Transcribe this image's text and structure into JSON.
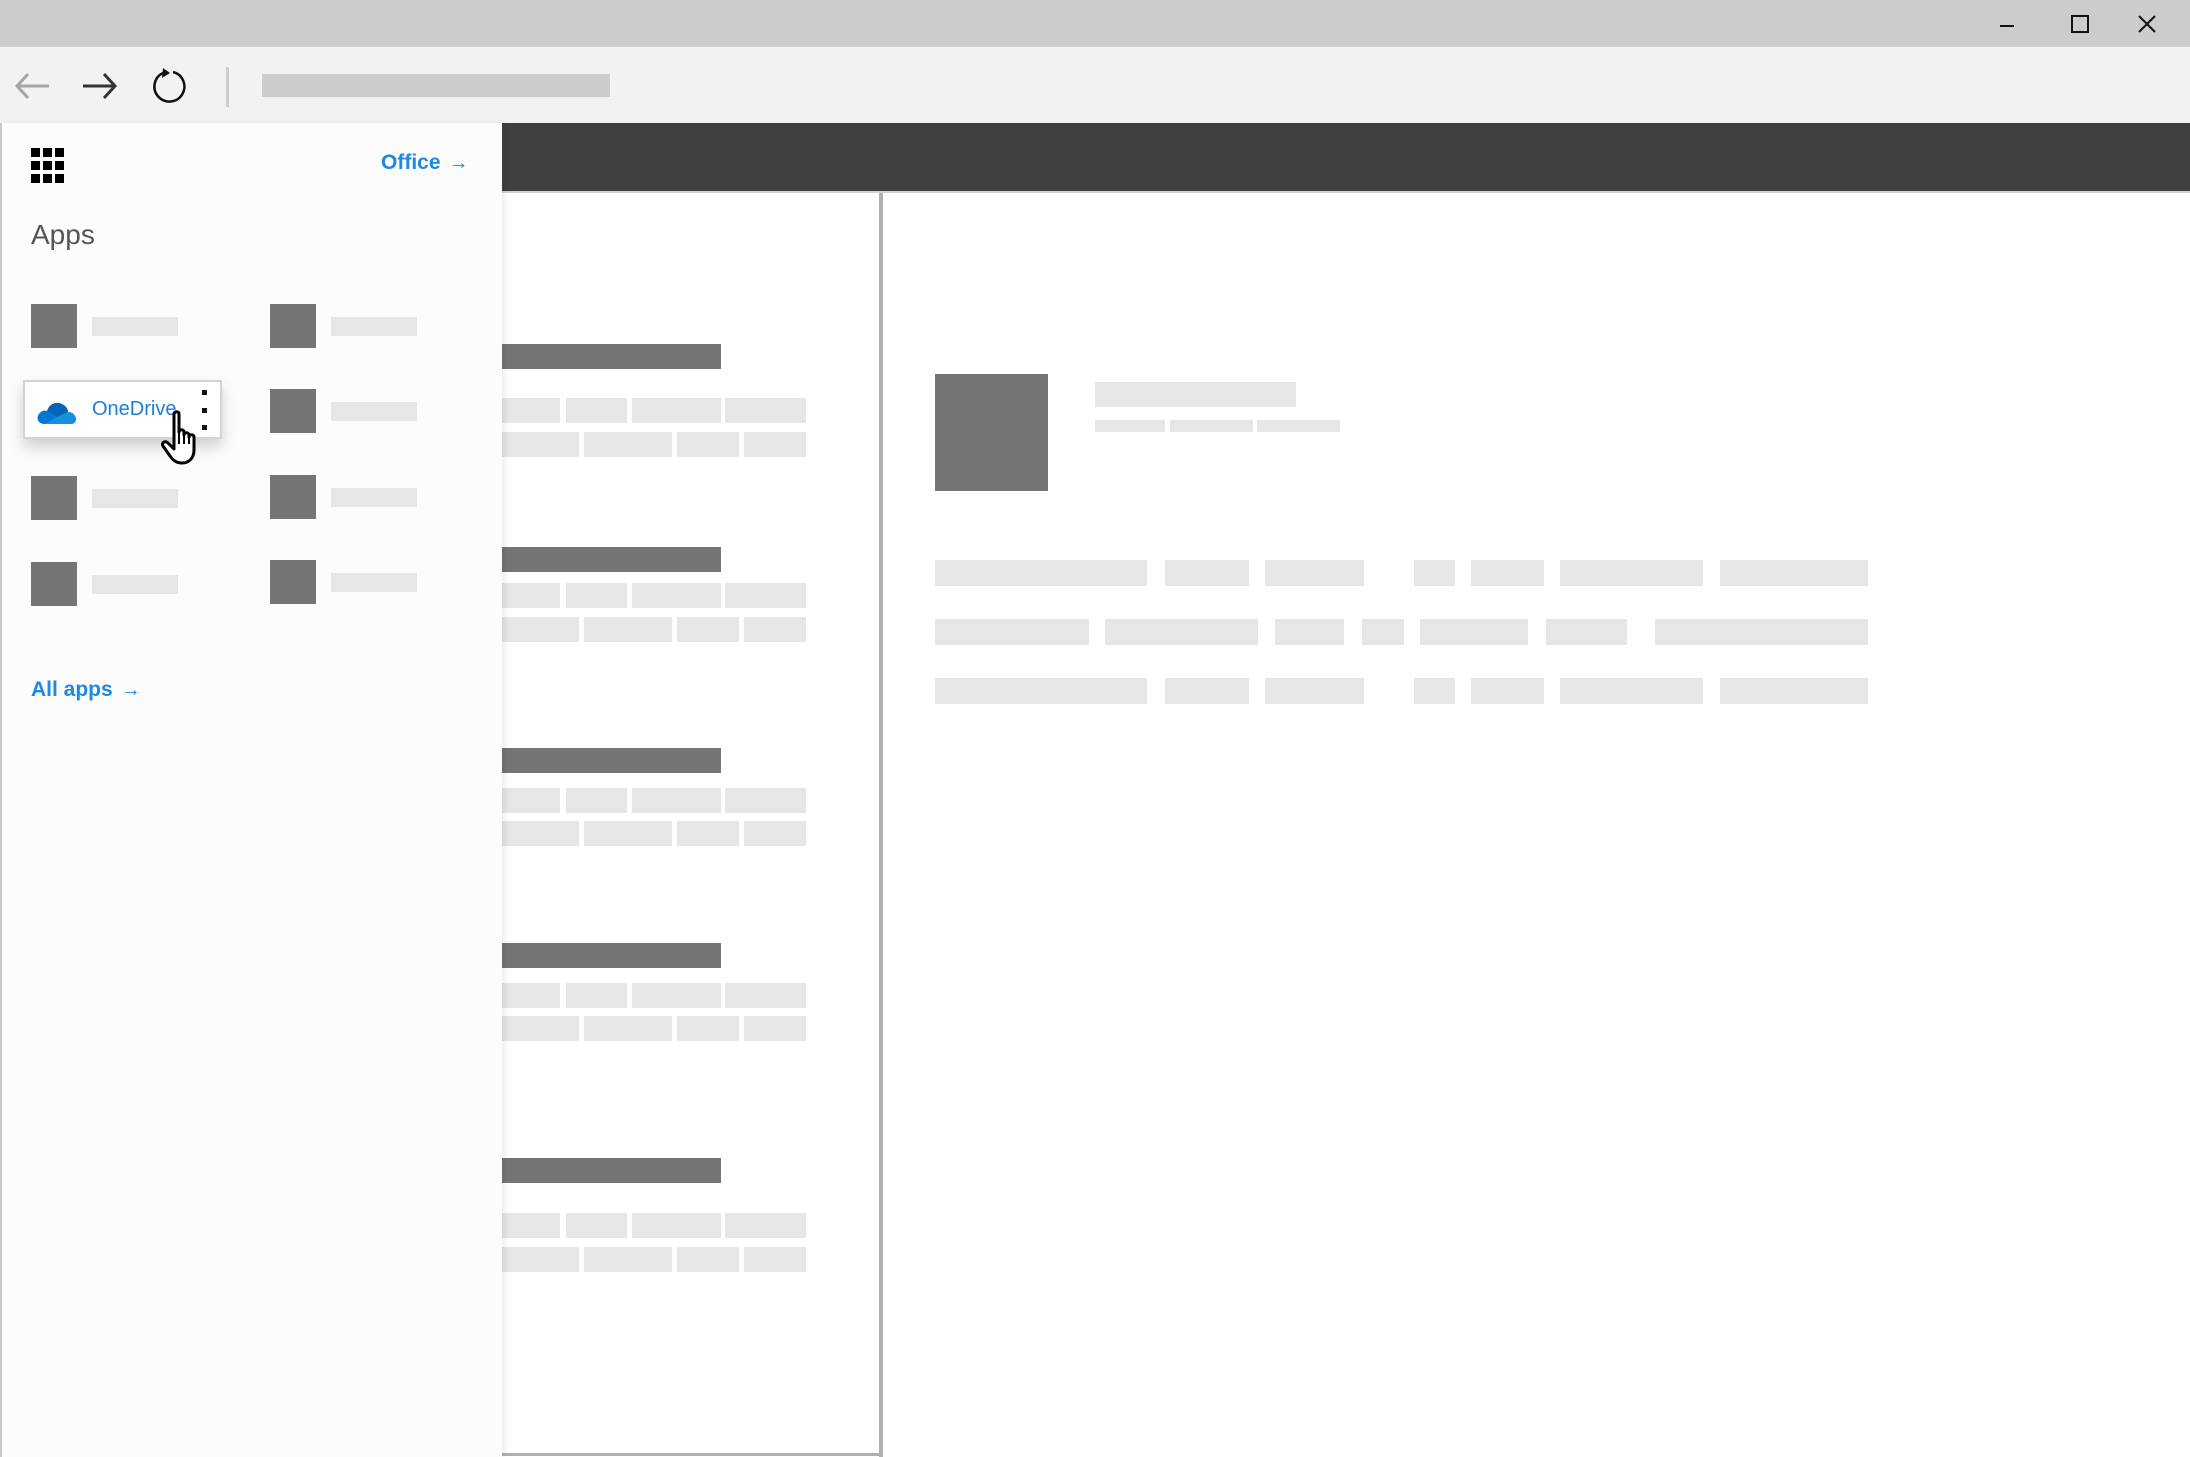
{
  "window": {
    "controls": [
      {
        "name": "minimize",
        "icon": "minimize-icon"
      },
      {
        "name": "maximize",
        "icon": "maximize-icon"
      },
      {
        "name": "close",
        "icon": "close-icon"
      }
    ]
  },
  "browser": {
    "back_icon": "arrow-left-icon",
    "forward_icon": "arrow-right-icon",
    "refresh_icon": "refresh-icon",
    "address_value": ""
  },
  "launcher": {
    "waffle_icon": "app-launcher-icon",
    "office_link": {
      "label": "Office",
      "arrow": "→"
    },
    "section_title": "Apps",
    "apps": [
      {
        "label": "",
        "placeholder": true
      },
      {
        "label": "",
        "placeholder": true
      },
      {
        "label": "OneDrive",
        "placeholder": false,
        "highlighted": true,
        "icon": "onedrive-cloud-icon"
      },
      {
        "label": "",
        "placeholder": true
      },
      {
        "label": "",
        "placeholder": true
      },
      {
        "label": "",
        "placeholder": true
      },
      {
        "label": "",
        "placeholder": true
      },
      {
        "label": "",
        "placeholder": true
      }
    ],
    "more_options_icon": "more-vertical-icon",
    "all_apps_link": {
      "label": "All apps",
      "arrow": "→"
    },
    "accent_color": "#1e88e5"
  },
  "content": {
    "header_color": "#404040",
    "list_groups": 5,
    "detail_rows": 3
  },
  "colors": {
    "placeholder_dark": "#757575",
    "placeholder_light": "#e6e6e6",
    "titlebar": "#cccccc",
    "toolbar": "#f2f2f2"
  }
}
